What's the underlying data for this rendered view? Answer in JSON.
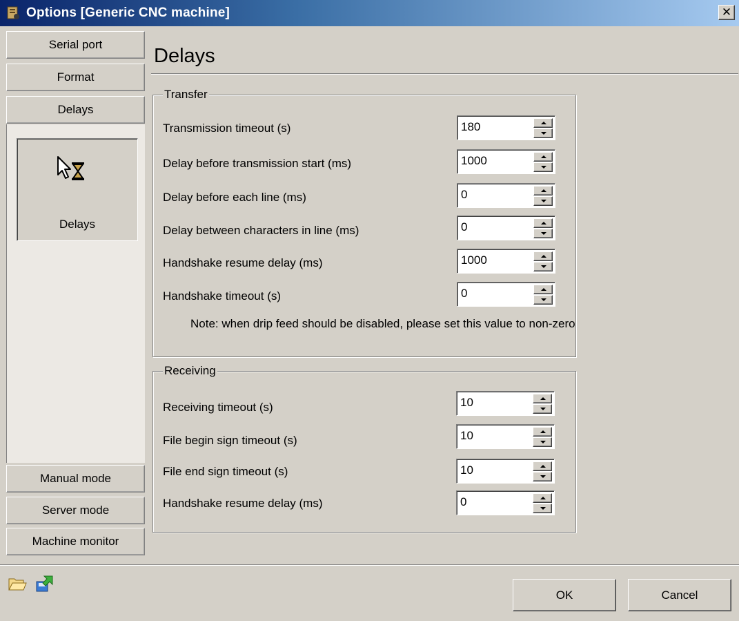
{
  "window": {
    "title": "Options [Generic CNC machine]",
    "close_glyph": "✕"
  },
  "nav": {
    "top_items": [
      {
        "label": "Serial port"
      },
      {
        "label": "Format"
      },
      {
        "label": "Delays"
      }
    ],
    "selected": {
      "label": "Delays",
      "icon": "cursor-hourglass-icon"
    },
    "bottom_items": [
      {
        "label": "Manual mode"
      },
      {
        "label": "Server mode"
      },
      {
        "label": "Machine monitor"
      }
    ]
  },
  "page": {
    "title": "Delays"
  },
  "transfer": {
    "legend": "Transfer",
    "fields": [
      {
        "label": "Transmission timeout (s)",
        "value": "180"
      },
      {
        "label": "Delay before transmission start (ms)",
        "value": "1000"
      },
      {
        "label": "Delay before each line (ms)",
        "value": "0"
      },
      {
        "label": "Delay between characters in line (ms)",
        "value": "0"
      },
      {
        "label": "Handshake resume delay (ms)",
        "value": "1000"
      },
      {
        "label": "Handshake timeout (s)",
        "value": "0"
      }
    ],
    "note": "Note: when drip feed should be disabled, please set this value to non-zero"
  },
  "receiving": {
    "legend": "Receiving",
    "fields": [
      {
        "label": "Receiving timeout (s)",
        "value": "10"
      },
      {
        "label": "File begin sign timeout (s)",
        "value": "10"
      },
      {
        "label": "File end sign timeout (s)",
        "value": "10"
      },
      {
        "label": "Handshake resume delay (ms)",
        "value": "0"
      }
    ]
  },
  "footer": {
    "tools": [
      {
        "icon": "open-folder-icon"
      },
      {
        "icon": "export-icon"
      }
    ],
    "ok_label": "OK",
    "cancel_label": "Cancel"
  }
}
